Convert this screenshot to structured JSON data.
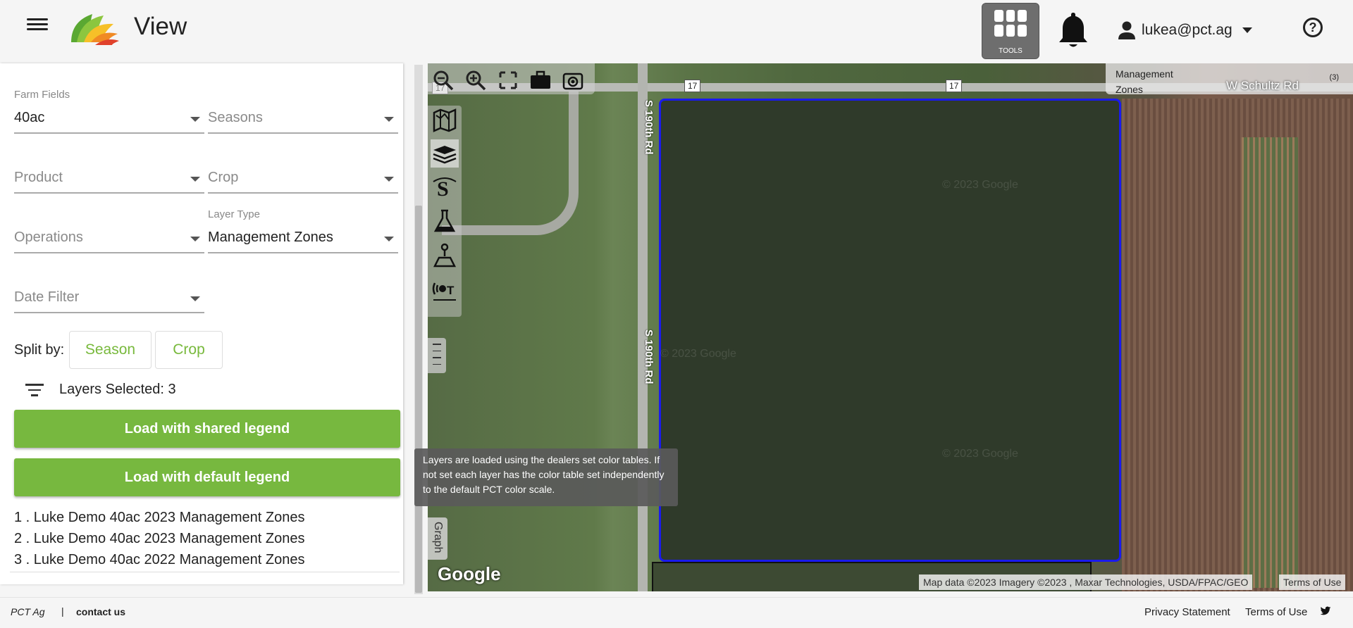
{
  "header": {
    "title": "View",
    "tools_label": "TOOLS",
    "user_email": "lukea@pct.ag",
    "help_symbol": "?"
  },
  "filters": {
    "farm_fields": {
      "label": "Farm Fields",
      "value": "40ac"
    },
    "seasons": {
      "placeholder": "Seasons"
    },
    "product": {
      "placeholder": "Product"
    },
    "crop": {
      "placeholder": "Crop"
    },
    "operations": {
      "placeholder": "Operations"
    },
    "layer_type": {
      "label": "Layer Type",
      "value": "Management Zones"
    },
    "date_filter": {
      "placeholder": "Date Filter"
    }
  },
  "split": {
    "label": "Split by:",
    "options": [
      "Season",
      "Crop"
    ]
  },
  "layers": {
    "selected_text": "Layers Selected: 3",
    "shared_legend_button": "Load with shared legend",
    "default_legend_button": "Load with default legend",
    "items": [
      "1 . Luke Demo 40ac 2023 Management Zones",
      "2 . Luke Demo 40ac 2023 Management Zones",
      "3 . Luke Demo 40ac 2022 Management Zones"
    ]
  },
  "map": {
    "road_names": [
      "S 190th Rd",
      "S 190th Rd"
    ],
    "street_name": "W Schultz Rd",
    "shields": [
      "17",
      "17",
      "17"
    ],
    "layer_label": "Management Zones",
    "layer_count": "(3)",
    "tooltip": "Layers are loaded using the dealers set color tables. If not set each layer has the color table set independently to the default PCT color scale.",
    "logo_text": "Google",
    "attribution": "Map data ©2023 Imagery ©2023 , Maxar Technologies, USDA/FPAC/GEO",
    "terms": "Terms of Use",
    "graph_tab": "Graph",
    "watermark": "© 2023 Google",
    "watermark_short": "© 2023 Google",
    "watermark_partial": "© 2023 Google"
  },
  "footer": {
    "brand": "PCT Ag",
    "separator": "|",
    "contact": "contact us",
    "privacy": "Privacy Statement",
    "terms": "Terms of Use"
  },
  "colors": {
    "accent_green": "#77b83f",
    "field_boundary": "#1a1aee",
    "tools_bg": "#6e6e6e"
  }
}
